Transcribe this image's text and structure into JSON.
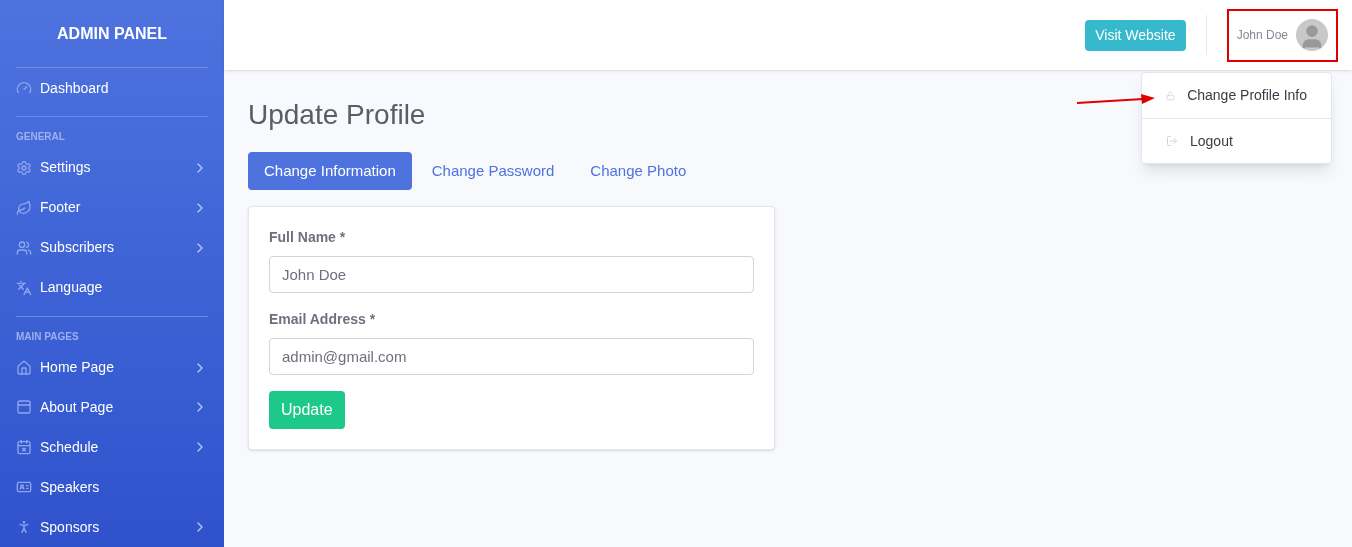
{
  "sidebar": {
    "brand": "ADMIN PANEL",
    "items": [
      {
        "kind": "item",
        "label": "Dashboard",
        "submenu": false
      },
      {
        "kind": "divider"
      },
      {
        "kind": "heading",
        "label": "GENERAL"
      },
      {
        "kind": "item",
        "label": "Settings",
        "submenu": true
      },
      {
        "kind": "item",
        "label": "Footer",
        "submenu": true
      },
      {
        "kind": "item",
        "label": "Subscribers",
        "submenu": true
      },
      {
        "kind": "item",
        "label": "Language",
        "submenu": false
      },
      {
        "kind": "divider"
      },
      {
        "kind": "heading",
        "label": "MAIN PAGES"
      },
      {
        "kind": "item",
        "label": "Home Page",
        "submenu": true
      },
      {
        "kind": "item",
        "label": "About Page",
        "submenu": true
      },
      {
        "kind": "item",
        "label": "Schedule",
        "submenu": true
      },
      {
        "kind": "item",
        "label": "Speakers",
        "submenu": false
      },
      {
        "kind": "item",
        "label": "Sponsors",
        "submenu": true
      }
    ]
  },
  "topbar": {
    "visit_button": "Visit Website",
    "user_name": "John Doe",
    "user_menu": {
      "open": true,
      "items": [
        "Change Profile Info",
        "Logout"
      ]
    }
  },
  "page": {
    "title": "Update Profile",
    "tabs": [
      {
        "label": "Change Information",
        "selected": true
      },
      {
        "label": "Change Password",
        "selected": false
      },
      {
        "label": "Change Photo",
        "selected": false
      }
    ],
    "form": {
      "fields": [
        {
          "label": "Full Name *",
          "value": "John Doe"
        },
        {
          "label": "Email Address *",
          "value": "admin@gmail.com"
        }
      ],
      "submit": "Update"
    }
  }
}
